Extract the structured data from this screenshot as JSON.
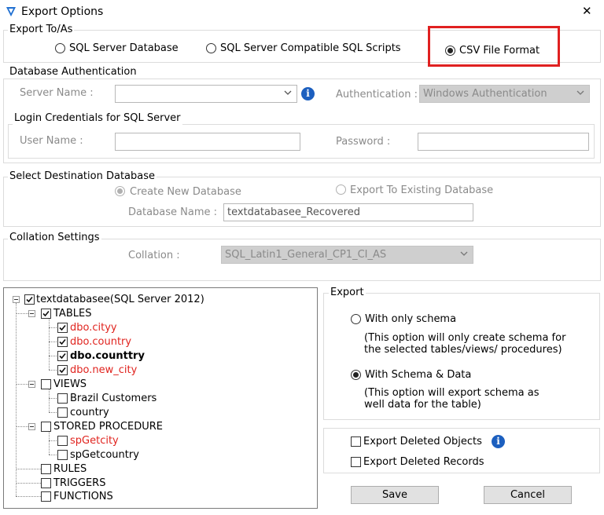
{
  "window": {
    "title": "Export Options",
    "close": "✕"
  },
  "export_to": {
    "legend": "Export To/As",
    "options": [
      {
        "label": "SQL Server Database",
        "selected": false
      },
      {
        "label": "SQL Server Compatible SQL Scripts",
        "selected": false
      },
      {
        "label": "CSV File Format",
        "selected": true
      }
    ]
  },
  "auth": {
    "legend": "Database Authentication",
    "server_label": "Server Name :",
    "server_value": "",
    "auth_label": "Authentication :",
    "auth_value": "Windows Authentication",
    "login_legend": "Login Credentials for SQL Server",
    "user_label": "User Name :",
    "password_label": "Password :"
  },
  "destination": {
    "legend": "Select Destination Database",
    "create_new": "Create New Database",
    "export_existing": "Export To Existing Database",
    "db_name_label": "Database Name :",
    "db_name_value": "textdatabasee_Recovered"
  },
  "collation": {
    "legend": "Collation Settings",
    "label": "Collation :",
    "value": "SQL_Latin1_General_CP1_CI_AS"
  },
  "tree": {
    "root": "textdatabasee(SQL Server 2012)",
    "tables": "TABLES",
    "tables_items": [
      "dbo.cityy",
      "dbo.country",
      "dbo.counttry",
      "dbo.new_city"
    ],
    "views": "VIEWS",
    "views_items": [
      "Brazil Customers",
      "country"
    ],
    "procs": "STORED PROCEDURE",
    "procs_items": [
      "spGetcity",
      "spGetcountry"
    ],
    "rules": "RULES",
    "triggers": "TRIGGERS",
    "functions": "FUNCTIONS"
  },
  "export": {
    "legend": "Export",
    "schema_only": "With only schema",
    "schema_only_desc1": "(This option will only create schema for",
    "schema_only_desc2": "the  selected tables/views/ procedures)",
    "schema_data": "With Schema & Data",
    "schema_data_desc1": "(This option will export schema as",
    "schema_data_desc2": "well data for the table)"
  },
  "options": {
    "deleted_objects": "Export Deleted Objects",
    "deleted_records": "Export Deleted Records"
  },
  "buttons": {
    "save": "Save",
    "cancel": "Cancel"
  },
  "colors": {
    "highlight": "#e02020",
    "info": "#1c5fbf",
    "deleted_item": "#e0241f"
  }
}
